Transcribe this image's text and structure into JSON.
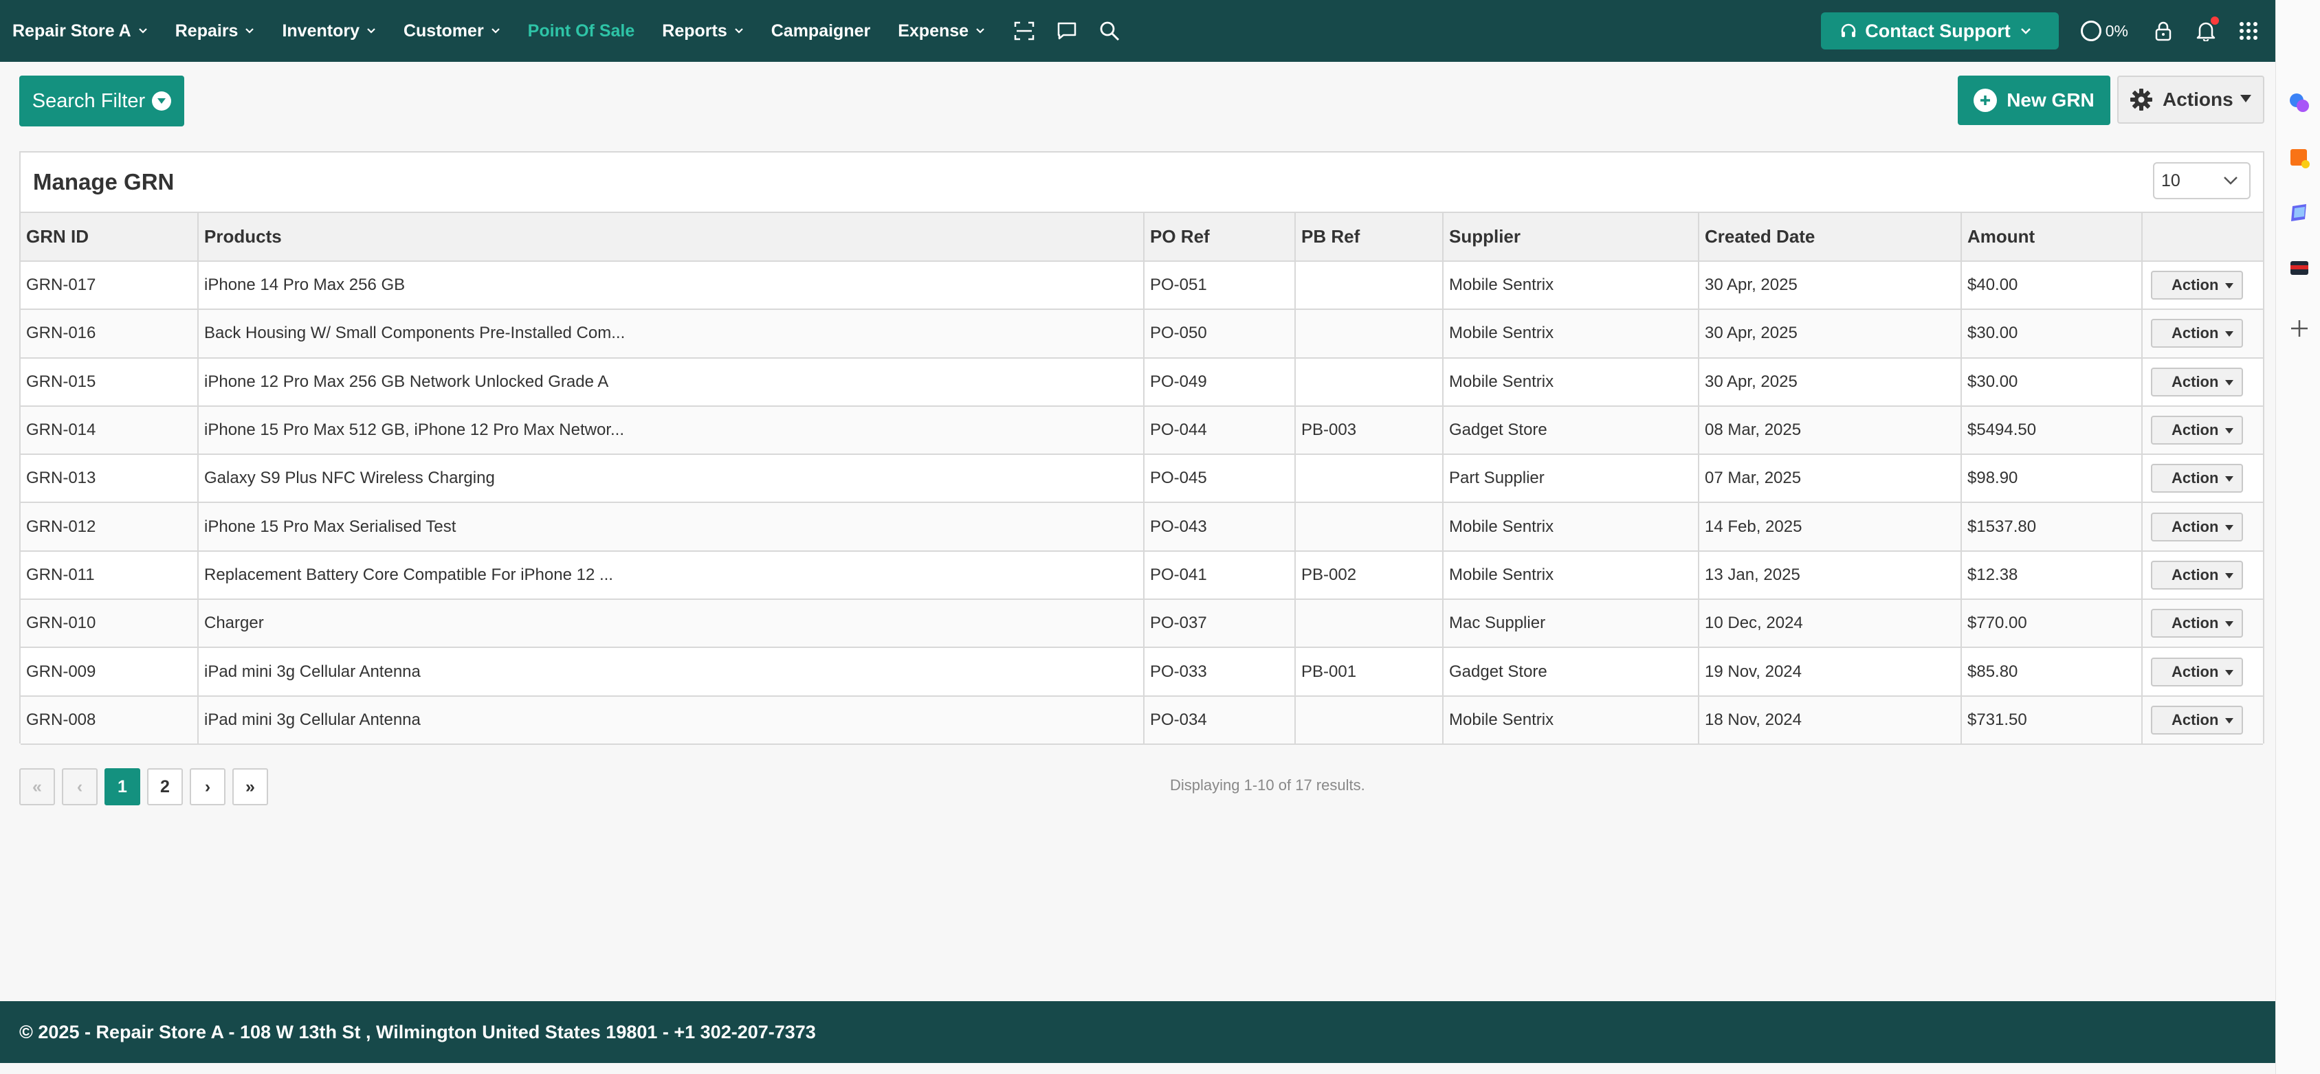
{
  "nav": {
    "items": [
      {
        "label": "Repair Store A",
        "has_chevron": true
      },
      {
        "label": "Repairs",
        "has_chevron": true
      },
      {
        "label": "Inventory",
        "has_chevron": true
      },
      {
        "label": "Customer",
        "has_chevron": true
      },
      {
        "label": "Point Of Sale",
        "has_chevron": false,
        "active": true
      },
      {
        "label": "Reports",
        "has_chevron": true
      },
      {
        "label": "Campaigner",
        "has_chevron": false
      },
      {
        "label": "Expense",
        "has_chevron": true
      }
    ],
    "icons": [
      "barcode-scan-icon",
      "chat-icon",
      "search-icon"
    ],
    "support_label": "Contact Support",
    "progress_label": "0%",
    "right_icons": [
      "lock-icon",
      "bell-icon",
      "apps-grid-icon"
    ]
  },
  "toolbar": {
    "search_filter_label": "Search Filter",
    "new_grn_label": "New GRN",
    "actions_label": "Actions"
  },
  "panel": {
    "title": "Manage GRN",
    "page_size": "10"
  },
  "table": {
    "columns": [
      "GRN ID",
      "Products",
      "PO Ref",
      "PB Ref",
      "Supplier",
      "Created Date",
      "Amount",
      ""
    ],
    "action_label": "Action",
    "rows": [
      {
        "id": "GRN-017",
        "products": "iPhone 14 Pro Max 256 GB",
        "po": "PO-051",
        "pb": "",
        "supplier": "Mobile Sentrix",
        "date": "30 Apr, 2025",
        "amount": "$40.00"
      },
      {
        "id": "GRN-016",
        "products": "Back Housing W/ Small Components Pre-Installed Com...",
        "po": "PO-050",
        "pb": "",
        "supplier": "Mobile Sentrix",
        "date": "30 Apr, 2025",
        "amount": "$30.00"
      },
      {
        "id": "GRN-015",
        "products": "iPhone 12 Pro Max 256 GB Network Unlocked Grade A",
        "po": "PO-049",
        "pb": "",
        "supplier": "Mobile Sentrix",
        "date": "30 Apr, 2025",
        "amount": "$30.00"
      },
      {
        "id": "GRN-014",
        "products": "iPhone 15 Pro Max 512 GB, iPhone 12 Pro Max Networ...",
        "po": "PO-044",
        "pb": "PB-003",
        "supplier": "Gadget Store",
        "date": "08 Mar, 2025",
        "amount": "$5494.50"
      },
      {
        "id": "GRN-013",
        "products": "Galaxy S9 Plus NFC Wireless Charging",
        "po": "PO-045",
        "pb": "",
        "supplier": "Part Supplier",
        "date": "07 Mar, 2025",
        "amount": "$98.90"
      },
      {
        "id": "GRN-012",
        "products": "iPhone 15 Pro Max Serialised Test",
        "po": "PO-043",
        "pb": "",
        "supplier": "Mobile Sentrix",
        "date": "14 Feb, 2025",
        "amount": "$1537.80"
      },
      {
        "id": "GRN-011",
        "products": "Replacement Battery Core Compatible For iPhone 12 ...",
        "po": "PO-041",
        "pb": "PB-002",
        "supplier": "Mobile Sentrix",
        "date": "13 Jan, 2025",
        "amount": "$12.38"
      },
      {
        "id": "GRN-010",
        "products": "Charger",
        "po": "PO-037",
        "pb": "",
        "supplier": "Mac Supplier",
        "date": "10 Dec, 2024",
        "amount": "$770.00"
      },
      {
        "id": "GRN-009",
        "products": "iPad mini 3g Cellular Antenna",
        "po": "PO-033",
        "pb": "PB-001",
        "supplier": "Gadget Store",
        "date": "19 Nov, 2024",
        "amount": "$85.80"
      },
      {
        "id": "GRN-008",
        "products": "iPad mini 3g Cellular Antenna",
        "po": "PO-034",
        "pb": "",
        "supplier": "Mobile Sentrix",
        "date": "18 Nov, 2024",
        "amount": "$731.50"
      }
    ]
  },
  "pagination": {
    "first": "«",
    "prev": "‹",
    "pages": [
      "1",
      "2"
    ],
    "current": "1",
    "next": "›",
    "last": "»",
    "info": "Displaying 1-10 of 17 results."
  },
  "footer": {
    "text": "© 2025 - Repair Store A - 108 W 13th St , Wilmington United States 19801 - +1 302-207-7373"
  },
  "colors": {
    "nav_bg": "#17494a",
    "accent": "#14917f",
    "active_nav": "#2ec4a7"
  }
}
